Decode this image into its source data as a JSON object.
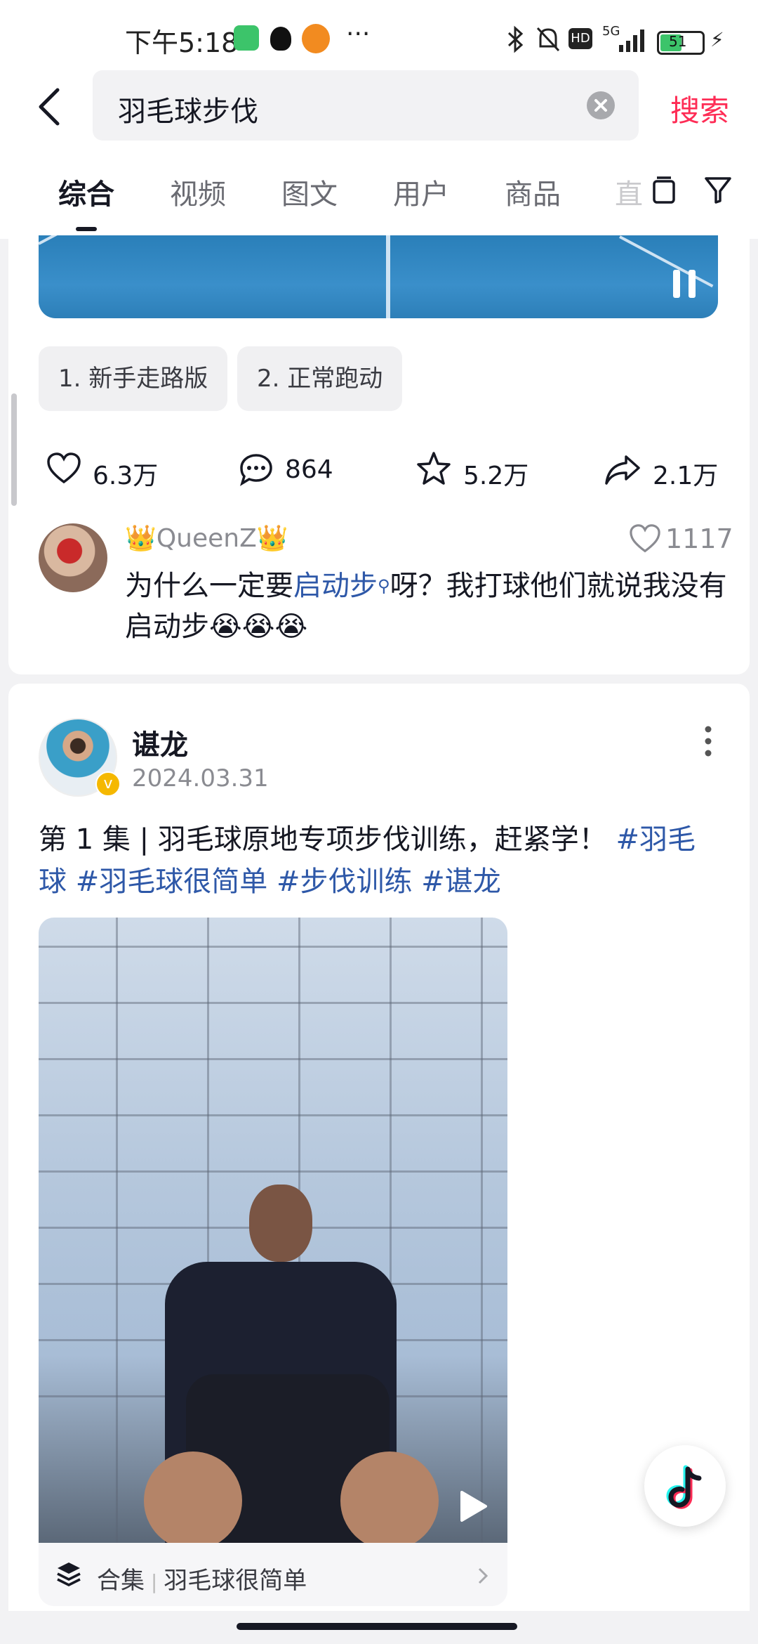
{
  "status_bar": {
    "time": "下午5:18",
    "network": "5G",
    "battery": "51",
    "hd": "HD"
  },
  "search": {
    "query": "羽毛球步伐",
    "button_label": "搜索"
  },
  "tabs": [
    {
      "label": "综合",
      "active": true
    },
    {
      "label": "视频"
    },
    {
      "label": "图文"
    },
    {
      "label": "用户"
    },
    {
      "label": "商品"
    },
    {
      "label": "直"
    }
  ],
  "post1": {
    "chips": [
      "1. 新手走路版",
      "2. 正常跑动"
    ],
    "likes": "6.3万",
    "comments": "864",
    "favorites": "5.2万",
    "shares": "2.1万",
    "top_comment": {
      "user": "QueenZ",
      "likes": "1117",
      "text_before": "为什么一定要",
      "link": "启动步",
      "text_after": "呀？我打球他们就说我没有启动步😭😭😭"
    }
  },
  "post2": {
    "author": "谌龙",
    "date": "2024.03.31",
    "desc": "第 1 集 | 羽毛球原地专项步伐训练，赶紧学！",
    "tags": [
      "#羽毛球",
      "#羽毛球很简单",
      "#步伐训练",
      "#谌龙"
    ],
    "collection_label": "合集",
    "collection_name": "羽毛球很简单"
  },
  "colors": {
    "accent": "#fe2c55",
    "link": "#2e58a8",
    "text": "#161823"
  }
}
